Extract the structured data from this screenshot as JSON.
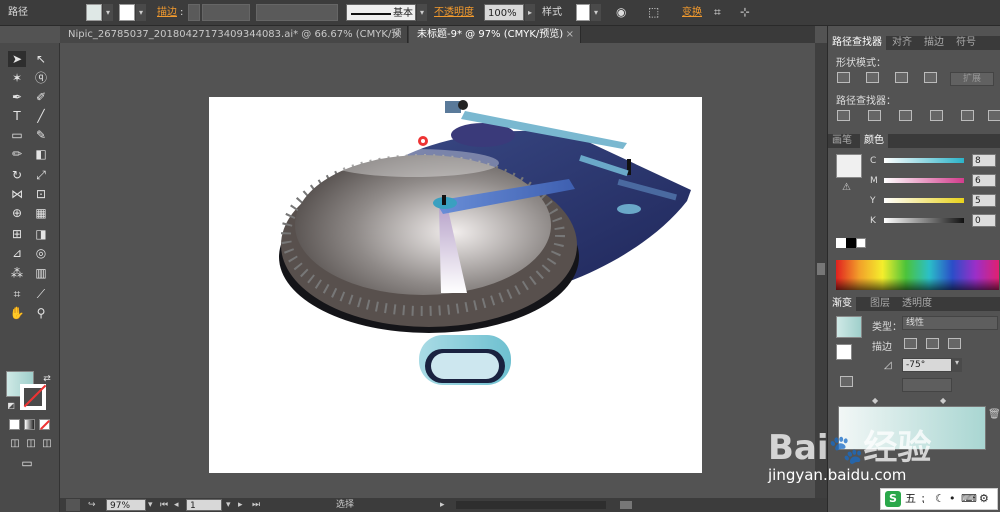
{
  "control_bar": {
    "selection_label": "路径",
    "stroke_label": "描边",
    "stroke_profile": "基本",
    "opacity_label": "不透明度",
    "opacity_value": "100%",
    "style_label": "样式",
    "transform_label": "变换"
  },
  "doc_tabs": [
    {
      "title": "Nipic_26785037_20180427173409344083.ai* @ 66.67% (CMYK/预览)"
    },
    {
      "title": "未标题-9* @ 97% (CMYK/预览)"
    }
  ],
  "status_bar": {
    "zoom": "97%",
    "artboard_number": "1",
    "tool_name": "选择"
  },
  "pathfinder_panel": {
    "tabs": [
      "路径查找器",
      "对齐",
      "描边",
      "符号"
    ],
    "shape_modes_label": "形状模式：",
    "expand_label": "扩展",
    "pathfinders_label": "路径查找器："
  },
  "color_panel": {
    "tabs": [
      "画笔",
      "颜色"
    ],
    "channels": [
      {
        "label": "C",
        "value": "8",
        "color": "#2bb3c8"
      },
      {
        "label": "M",
        "value": "6",
        "color": "#d33c8c"
      },
      {
        "label": "Y",
        "value": "5",
        "color": "#e8d21c"
      },
      {
        "label": "K",
        "value": "0",
        "color": "#222222"
      }
    ]
  },
  "gradient_panel": {
    "tabs": [
      "渐变",
      "图层",
      "透明度"
    ],
    "type_label": "类型：",
    "type_value": "线性",
    "stroke_label": "描边",
    "angle_value": "-75°"
  },
  "watermark": {
    "brand": "Bai",
    "brand_suffix": "经验",
    "url": "jingyan.baidu.com"
  },
  "ime_bar": {
    "label": "五"
  },
  "colors": {
    "accent_orange": "#f29a2e",
    "turntable_navy": "#2a3470",
    "platter_gray": "#8a8683"
  }
}
